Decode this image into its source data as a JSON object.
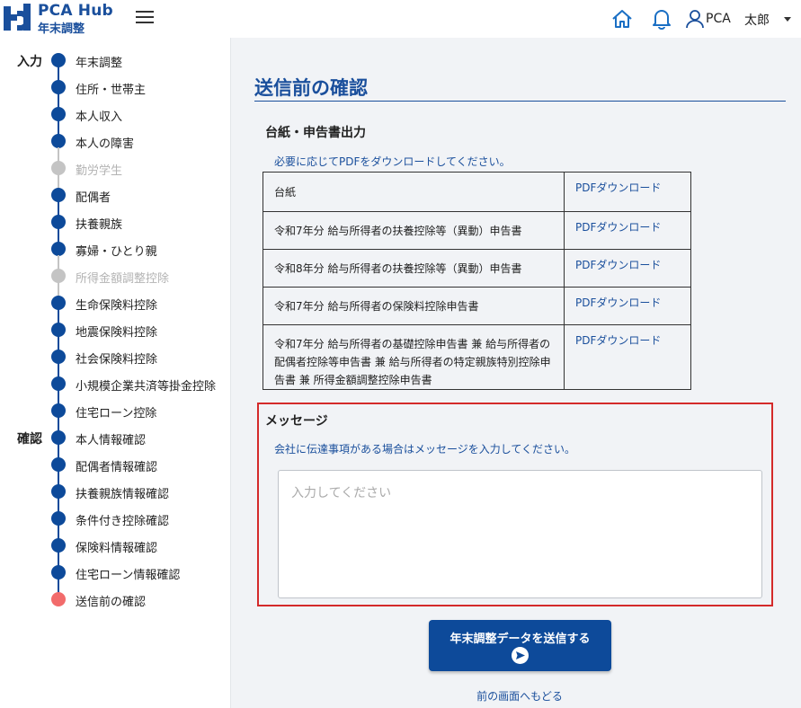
{
  "header": {
    "brand": "PCA Hub",
    "brand_sub": "年末調整",
    "icons": [
      "menu-icon",
      "home-icon",
      "bell-icon",
      "user-icon",
      "caret-down-icon"
    ],
    "user_org": "PCA",
    "user_name": "太郎"
  },
  "sidebar": {
    "section_input": "入力",
    "section_confirm": "確認",
    "steps": [
      {
        "label": "年末調整",
        "state": "done"
      },
      {
        "label": "住所・世帯主",
        "state": "done"
      },
      {
        "label": "本人収入",
        "state": "done"
      },
      {
        "label": "本人の障害",
        "state": "done"
      },
      {
        "label": "勤労学生",
        "state": "disabled"
      },
      {
        "label": "配偶者",
        "state": "done"
      },
      {
        "label": "扶養親族",
        "state": "done"
      },
      {
        "label": "寡婦・ひとり親",
        "state": "done"
      },
      {
        "label": "所得金額調整控除",
        "state": "disabled"
      },
      {
        "label": "生命保険料控除",
        "state": "done"
      },
      {
        "label": "地震保険料控除",
        "state": "done"
      },
      {
        "label": "社会保険料控除",
        "state": "done"
      },
      {
        "label": "小規模企業共済等掛金控除",
        "state": "done"
      },
      {
        "label": "住宅ローン控除",
        "state": "done"
      },
      {
        "label": "本人情報確認",
        "state": "done"
      },
      {
        "label": "配偶者情報確認",
        "state": "done"
      },
      {
        "label": "扶養親族情報確認",
        "state": "done"
      },
      {
        "label": "条件付き控除確認",
        "state": "done"
      },
      {
        "label": "保険料情報確認",
        "state": "done"
      },
      {
        "label": "住宅ローン情報確認",
        "state": "done"
      },
      {
        "label": "送信前の確認",
        "state": "current"
      }
    ],
    "colors": {
      "done": "#0d4a9a",
      "disabled": "#c4c4c4",
      "current": "#f26b6b"
    }
  },
  "main": {
    "title": "送信前の確認",
    "forms_section": {
      "title": "台紙・申告書出力",
      "hint": "必要に応じてPDFをダウンロードしてください。",
      "rows": [
        {
          "name": "台紙",
          "link": "PDFダウンロード"
        },
        {
          "name": "令和7年分 給与所得者の扶養控除等（異動）申告書",
          "link": "PDFダウンロード"
        },
        {
          "name": "令和8年分 給与所得者の扶養控除等（異動）申告書",
          "link": "PDFダウンロード"
        },
        {
          "name": "令和7年分 給与所得者の保険料控除申告書",
          "link": "PDFダウンロード"
        },
        {
          "name": "令和7年分 給与所得者の基礎控除申告書 兼 給与所得者の配偶者控除等申告書 兼 給与所得者の特定親族特別控除申告書 兼 所得金額調整控除申告書",
          "link": "PDFダウンロード"
        }
      ]
    },
    "message_section": {
      "title": "メッセージ",
      "hint": "会社に伝達事項がある場合はメッセージを入力してください。",
      "placeholder": "入力してください",
      "value": ""
    },
    "submit_label": "年末調整データを送信する",
    "back_label": "前の画面へもどる",
    "accent_color": "#0d4a9a",
    "highlight_color": "#d42a2a"
  }
}
